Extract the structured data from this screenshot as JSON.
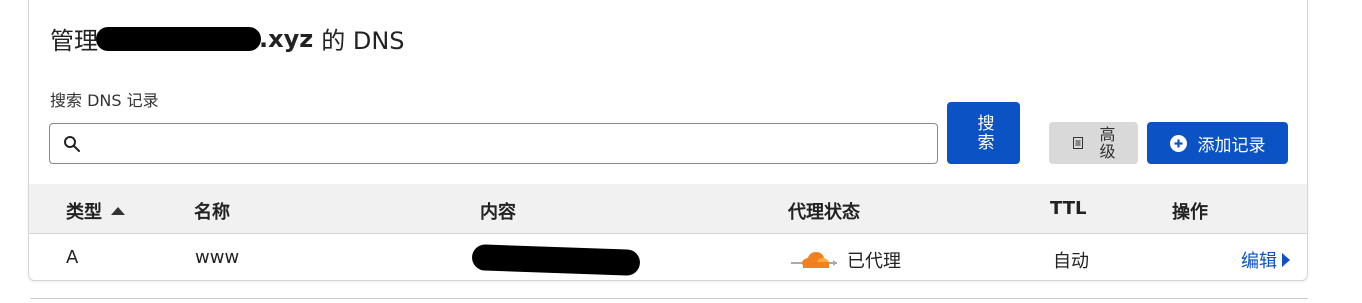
{
  "header": {
    "title_prefix": "管理",
    "domain_suffix": ".xyz",
    "title_suffix": "的 DNS"
  },
  "search": {
    "label": "搜索 DNS 记录",
    "value": "",
    "placeholder": "",
    "button_label": "搜索"
  },
  "toolbar": {
    "advanced_label": "高级",
    "add_record_label": "添加记录"
  },
  "table": {
    "columns": [
      "类型",
      "名称",
      "内容",
      "代理状态",
      "TTL",
      "操作"
    ],
    "rows": [
      {
        "type": "A",
        "name": "www",
        "content": "",
        "proxy_status": "已代理",
        "ttl": "自动",
        "action": "编辑"
      }
    ]
  },
  "colors": {
    "primary": "#0b52c4",
    "proxy_cloud": "#f38020",
    "header_bg": "#f1f1f1",
    "secondary_button_bg": "#d9d9d9"
  },
  "icons": {
    "search": "search-icon",
    "advanced": "document-icon",
    "add": "plus-circle-icon",
    "sort": "sort-up-icon",
    "proxy": "cloud-icon",
    "edit_chevron": "chevron-right-icon"
  }
}
